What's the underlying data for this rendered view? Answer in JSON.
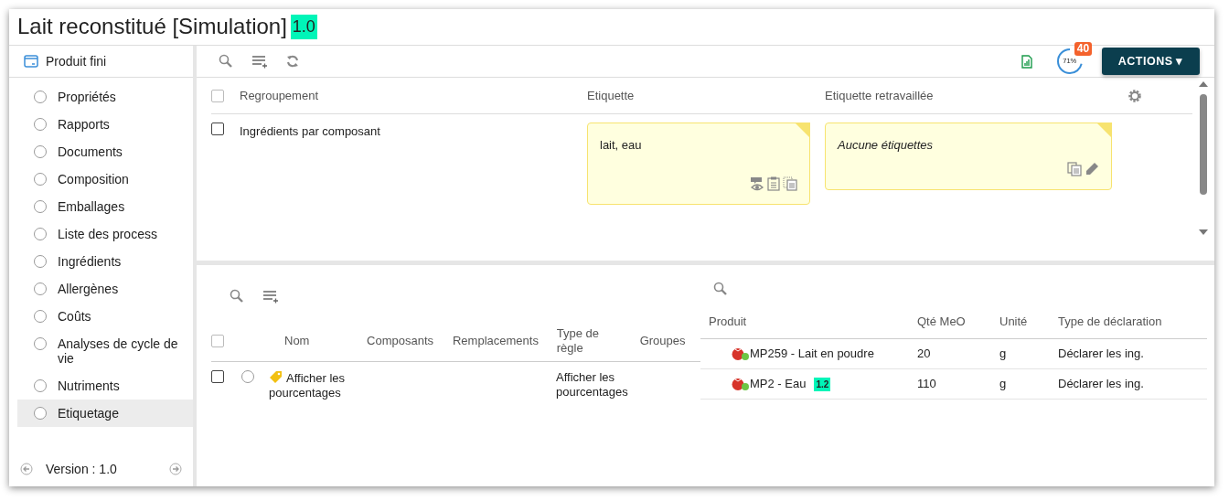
{
  "window": {
    "title": "Lait reconstitué [Simulation]",
    "version_badge": "1.0"
  },
  "sidebar": {
    "header": "Produit fini",
    "items": [
      {
        "label": "Propriétés",
        "selected": false
      },
      {
        "label": "Rapports",
        "selected": false
      },
      {
        "label": "Documents",
        "selected": false
      },
      {
        "label": "Composition",
        "selected": false
      },
      {
        "label": "Emballages",
        "selected": false
      },
      {
        "label": "Liste des process",
        "selected": false
      },
      {
        "label": "Ingrédients",
        "selected": false
      },
      {
        "label": "Allergènes",
        "selected": false
      },
      {
        "label": "Coûts",
        "selected": false
      },
      {
        "label": "Analyses de cycle de vie",
        "selected": false
      },
      {
        "label": "Nutriments",
        "selected": false
      },
      {
        "label": "Etiquetage",
        "selected": true
      }
    ],
    "footer": "Version : 1.0"
  },
  "toolbar": {
    "progress": {
      "reading": "71%"
    },
    "notification_count": "40",
    "actions_button": "ACTIONS ▾"
  },
  "labels_table": {
    "all_checked": false,
    "columns": [
      "Regroupement",
      "Etiquette",
      "Etiquette retravaillée"
    ],
    "rows": [
      {
        "checked": false,
        "grouping": "Ingrédients par composant",
        "label": "lait, eau",
        "reworked_label": "Aucune étiquettes"
      }
    ]
  },
  "rules_table": {
    "all_checked": false,
    "columns": [
      "Nom",
      "Composants",
      "Remplacements",
      "Type de règle",
      "Groupes"
    ],
    "rows": [
      {
        "checked": false,
        "selected": false,
        "name": "Afficher les pourcentages",
        "rule_type": "Afficher les pourcentages"
      }
    ]
  },
  "products_table": {
    "columns": [
      "Produit",
      "Qté MeO",
      "Unité",
      "Type de déclaration"
    ],
    "rows": [
      {
        "product": "MP259 - Lait en poudre",
        "quantity": "20",
        "unit": "g",
        "declaration": "Déclarer les ing."
      },
      {
        "product": "MP2 - Eau",
        "version_badge": "1.2",
        "quantity": "110",
        "unit": "g",
        "declaration": "Déclarer les ing."
      }
    ]
  }
}
